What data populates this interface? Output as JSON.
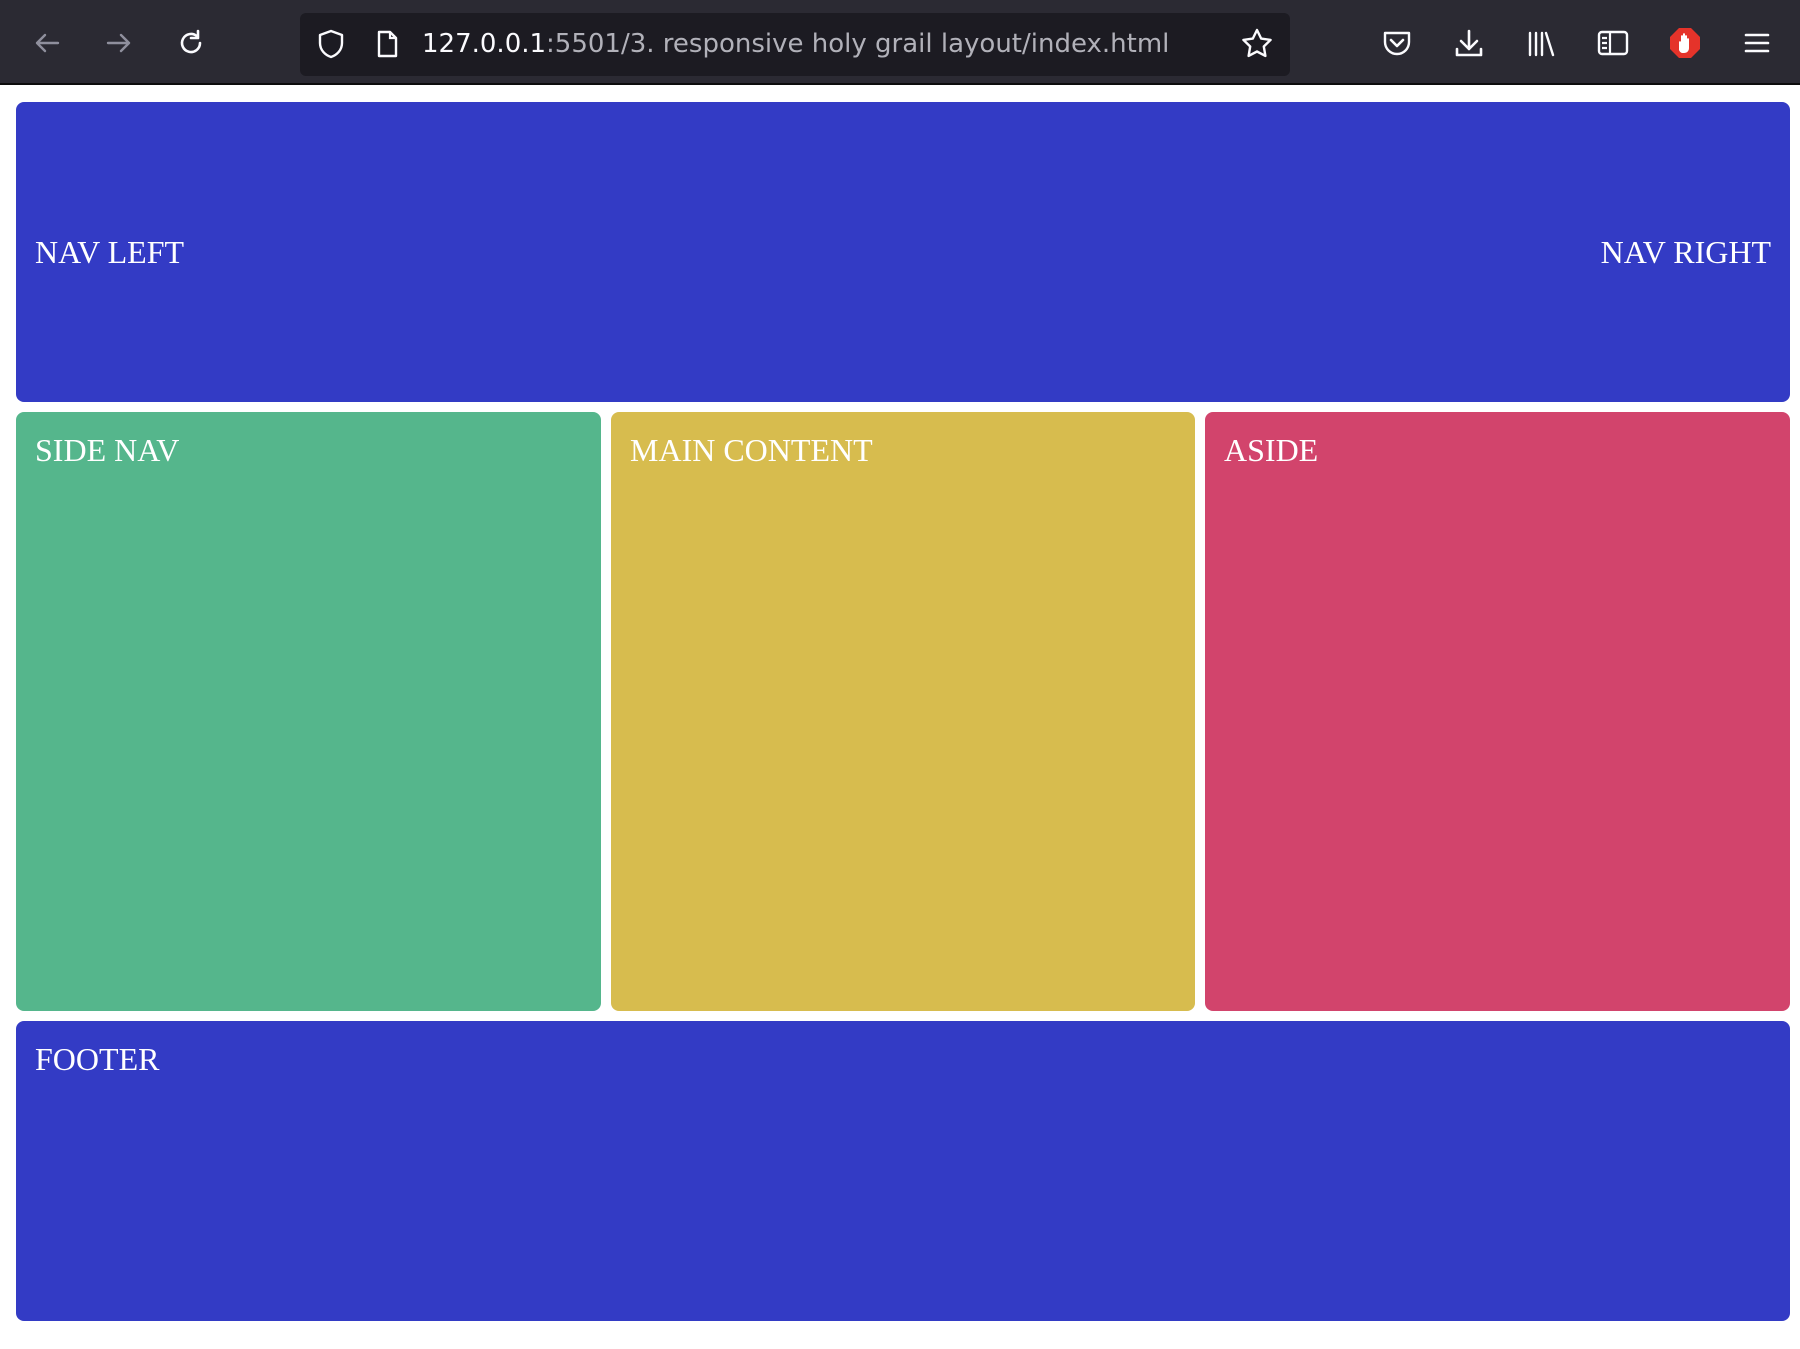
{
  "browser": {
    "url_host": "127.0.0.1",
    "url_rest": ":5501/3. responsive holy grail layout/index.html",
    "icons": [
      "back-icon",
      "forward-icon",
      "reload-icon",
      "shield-icon",
      "page-icon",
      "bookmark-star-icon",
      "pocket-icon",
      "download-icon",
      "library-icon",
      "sidebar-icon",
      "adblock-icon",
      "menu-icon"
    ]
  },
  "layout": {
    "nav_left": "NAV LEFT",
    "nav_right": "NAV RIGHT",
    "side_nav": "SIDE NAV",
    "main_content": "MAIN CONTENT",
    "aside": "ASIDE",
    "footer": "FOOTER"
  },
  "colors": {
    "nav": "#333bc5",
    "side_nav": "#55b68c",
    "main_content": "#d7bc4e",
    "aside": "#d2446c",
    "footer": "#333bc5",
    "toolbar": "#2b2a33",
    "urlbar": "#1c1b22"
  }
}
